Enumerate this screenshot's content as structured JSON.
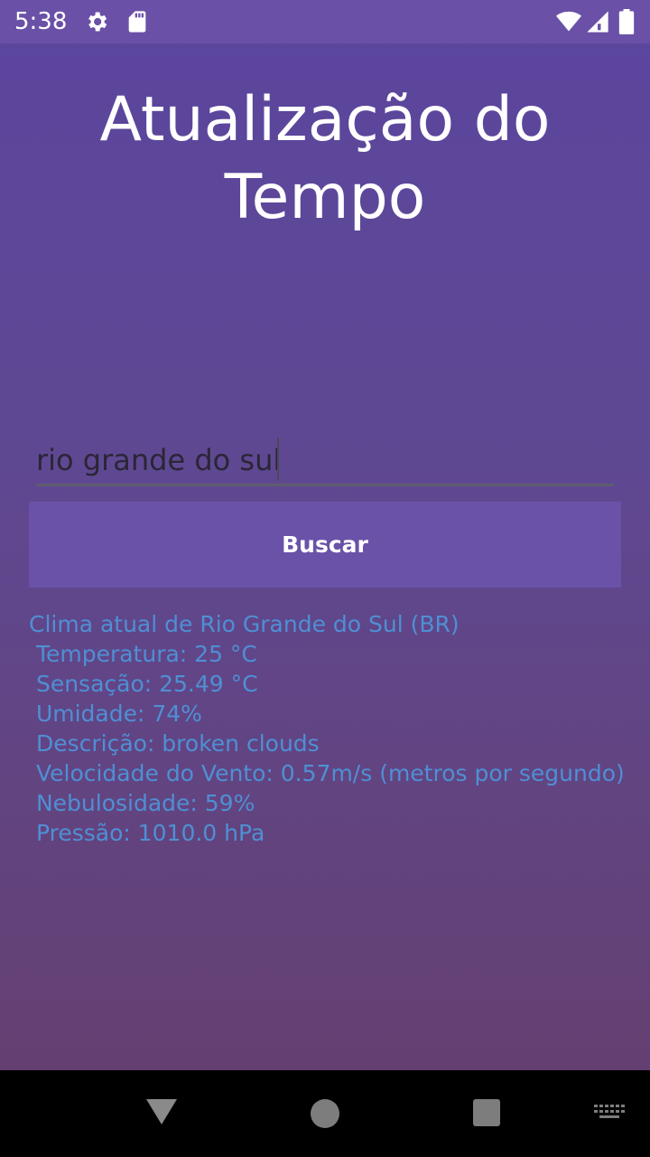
{
  "status_bar": {
    "time": "5:38",
    "icons": [
      "gear-icon",
      "sd-card-icon",
      "wifi-icon",
      "signal-icon",
      "battery-icon"
    ]
  },
  "app": {
    "title": "Atualização do Tempo"
  },
  "search": {
    "value": "rio grande do sul",
    "button_label": "Buscar"
  },
  "result": {
    "lines": [
      "Clima atual de Rio Grande do Sul (BR)",
      " Temperatura: 25 °C",
      " Sensação: 25.49 °C",
      " Umidade: 74%",
      " Descrição: broken clouds",
      " Velocidade do Vento: 0.57m/s (metros por segundo)",
      " Nebulosidade: 59%",
      " Pressão: 1010.0 hPa"
    ]
  },
  "nav_bar": {
    "icons": [
      "back-icon",
      "home-icon",
      "recents-icon",
      "keyboard-icon"
    ]
  },
  "colors": {
    "status_bar": "#6a51a7",
    "button": "#6a52a8",
    "result_text": "#4f8fd4"
  }
}
